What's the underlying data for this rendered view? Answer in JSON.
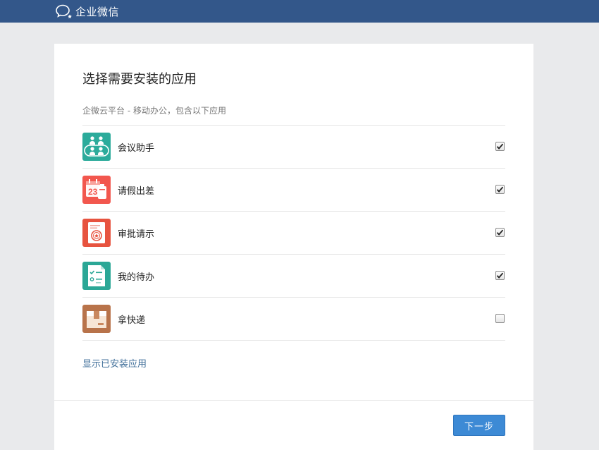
{
  "header": {
    "brand_name": "企业微信",
    "logo_icon": "chat-bubble-icon",
    "bg_color": "#33578a"
  },
  "page": {
    "title": "选择需要安装的应用",
    "subtitle": "企微云平台 - 移动办公，包含以下应用"
  },
  "apps": [
    {
      "name": "会议助手",
      "icon": "meeting-people-icon",
      "color": "#2bab9b",
      "checked": true
    },
    {
      "name": "请假出差",
      "icon": "calendar-leave-icon",
      "color": "#f2574e",
      "checked": true
    },
    {
      "name": "审批请示",
      "icon": "approval-stamp-icon",
      "color": "#e7533f",
      "checked": true
    },
    {
      "name": "我的待办",
      "icon": "todo-checklist-icon",
      "color": "#2ba796",
      "checked": true
    },
    {
      "name": "拿快递",
      "icon": "package-box-icon",
      "color": "#b8734a",
      "checked": false
    }
  ],
  "links": {
    "show_installed": "显示已安装应用"
  },
  "actions": {
    "next_label": "下一步",
    "accent": "#3d8ad5"
  }
}
